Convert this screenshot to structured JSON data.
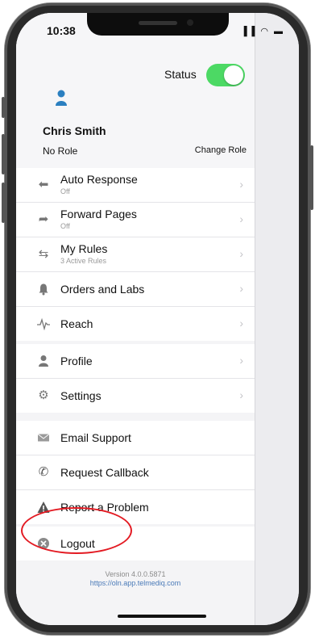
{
  "status_bar": {
    "time": "10:38",
    "icons": "▐▐ ◠ ▬"
  },
  "header": {
    "status_label": "Status",
    "user_name": "Chris Smith",
    "role": "No Role",
    "change_role": "Change Role"
  },
  "menu_primary": [
    {
      "label": "Auto Response",
      "sub": "Off",
      "icon": "reply-icon"
    },
    {
      "label": "Forward Pages",
      "sub": "Off",
      "icon": "forward-icon"
    },
    {
      "label": "My Rules",
      "sub": "3 Active Rules",
      "icon": "rules-icon"
    },
    {
      "label": "Orders and Labs",
      "sub": "",
      "icon": "bell-icon"
    },
    {
      "label": "Reach",
      "sub": "",
      "icon": "pulse-icon"
    }
  ],
  "menu_account": [
    {
      "label": "Profile",
      "icon": "person-icon"
    },
    {
      "label": "Settings",
      "icon": "gear-icon"
    }
  ],
  "menu_support": [
    {
      "label": "Email Support",
      "icon": "envelope-icon"
    },
    {
      "label": "Request Callback",
      "icon": "phone-icon"
    },
    {
      "label": "Report a Problem",
      "icon": "warning-icon"
    }
  ],
  "menu_logout": {
    "label": "Logout",
    "icon": "close-circle-icon"
  },
  "footer": {
    "version": "Version 4.0.0.5871",
    "url": "https://oln.app.telmediq.com"
  },
  "colors": {
    "toggle_on": "#4cd964",
    "annotation": "#e31b23",
    "link": "#4a7ab8"
  }
}
